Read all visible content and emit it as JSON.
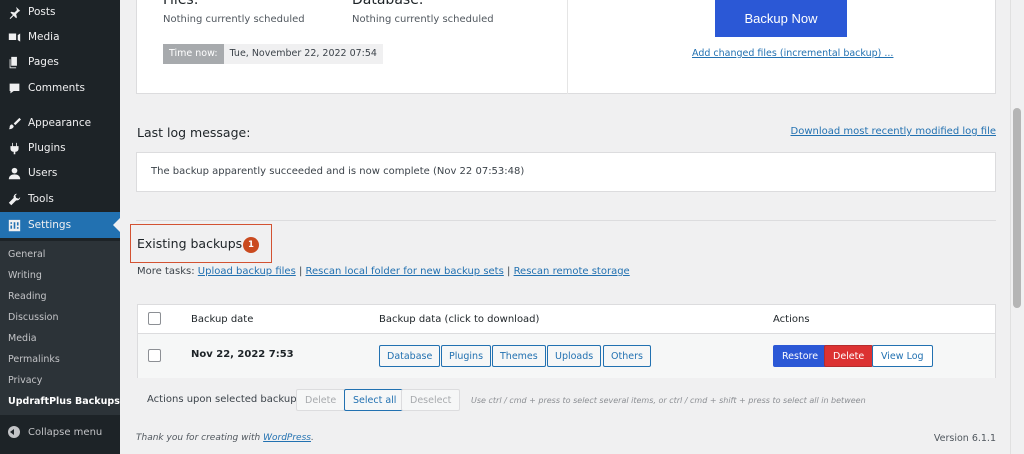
{
  "sidebar": {
    "items": [
      {
        "label": "Posts",
        "icon": "pin-icon"
      },
      {
        "label": "Media",
        "icon": "media-icon"
      },
      {
        "label": "Pages",
        "icon": "pages-icon"
      },
      {
        "label": "Comments",
        "icon": "comment-icon"
      },
      {
        "label": "Appearance",
        "icon": "brush-icon"
      },
      {
        "label": "Plugins",
        "icon": "plug-icon"
      },
      {
        "label": "Users",
        "icon": "user-icon"
      },
      {
        "label": "Tools",
        "icon": "wrench-icon"
      },
      {
        "label": "Settings",
        "icon": "settings-icon"
      }
    ],
    "submenu": [
      "General",
      "Writing",
      "Reading",
      "Discussion",
      "Media",
      "Permalinks",
      "Privacy",
      "UpdraftPlus Backups"
    ],
    "collapse_label": "Collapse menu"
  },
  "schedule": {
    "files_heading": "Files:",
    "files_value": "Nothing currently scheduled",
    "database_heading": "Database:",
    "database_value": "Nothing currently scheduled",
    "time_now_label": "Time now:",
    "time_now_value": "Tue, November 22, 2022 07:54",
    "backup_now_label": "Backup Now",
    "incremental_link": "Add changed files (incremental backup) ..."
  },
  "log": {
    "heading": "Last log message:",
    "download_link": "Download most recently modified log file",
    "message": "The backup apparently succeeded and is now complete (Nov 22 07:53:48)"
  },
  "existing": {
    "heading": "Existing backups",
    "count": "1",
    "more_tasks_label": "More tasks:",
    "upload_link": "Upload backup files",
    "sep": "|",
    "rescan_local_link": "Rescan local folder for new backup sets",
    "rescan_remote_link": "Rescan remote storage"
  },
  "table": {
    "headers": {
      "date": "Backup date",
      "data": "Backup data (click to download)",
      "actions": "Actions"
    },
    "row": {
      "date": "Nov 22, 2022 7:53",
      "data_buttons": [
        "Database",
        "Plugins",
        "Themes",
        "Uploads",
        "Others"
      ],
      "restore": "Restore",
      "delete": "Delete",
      "view_log": "View Log"
    }
  },
  "bulk": {
    "label": "Actions upon selected backups",
    "delete": "Delete",
    "select_all": "Select all",
    "deselect": "Deselect",
    "hint": "Use ctrl / cmd + press to select several items, or ctrl / cmd + shift + press to select all in between"
  },
  "footer": {
    "thanks_prefix": "Thank you for creating with",
    "wordpress_link": "WordPress",
    "thanks_suffix": ".",
    "version": "Version 6.1.1"
  },
  "colors": {
    "sidebar_bg": "#1d2327",
    "accent": "#2271b1",
    "primary_button": "#2b58d6",
    "delete": "#dc3232",
    "highlight_border": "#d35232"
  }
}
